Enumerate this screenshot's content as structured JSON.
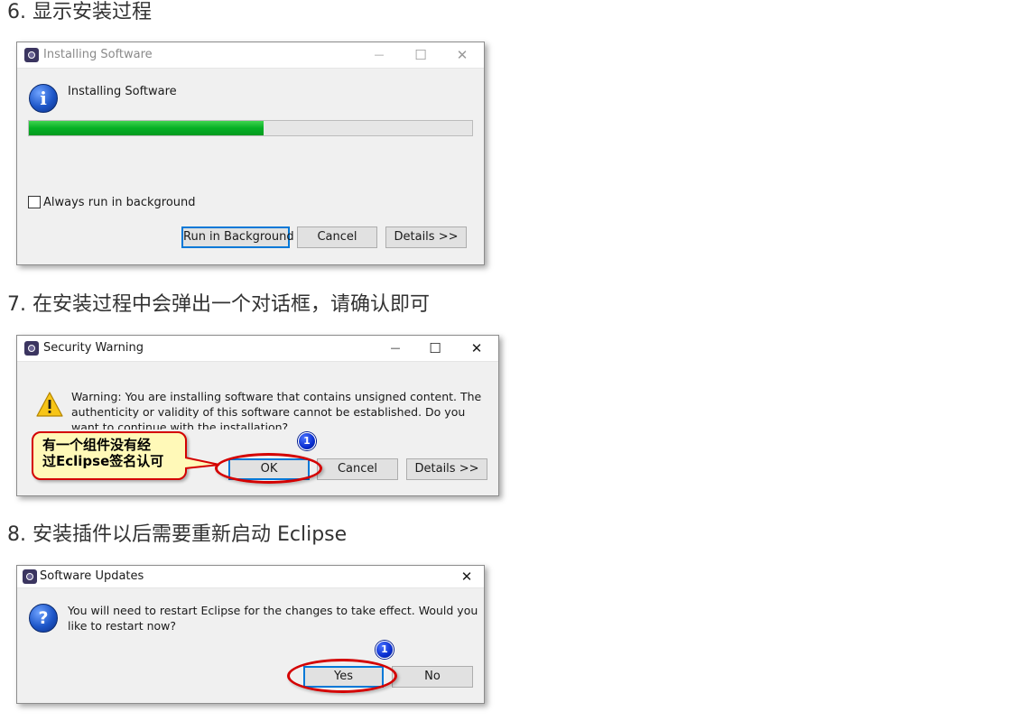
{
  "headings": {
    "step6": "6. 显示安装过程",
    "step7": "7. 在安装过程中会弹出一个对话框，请确认即可",
    "step8": "8. 安装插件以后需要重新启动 Eclipse"
  },
  "installing_dialog": {
    "title": "Installing Software",
    "message": "Installing Software",
    "progress_fraction": 0.53,
    "always_background_label": "Always run in background",
    "always_background_checked": false,
    "buttons": {
      "run_background": "Run in Background",
      "cancel": "Cancel",
      "details": "Details >>"
    }
  },
  "security_dialog": {
    "title": "Security Warning",
    "message": "Warning: You are installing software that contains unsigned content. The authenticity or validity of this software cannot be established. Do you want to continue with the installation?",
    "buttons": {
      "ok": "OK",
      "cancel": "Cancel",
      "details": "Details >>"
    },
    "callout_line1": "有一个组件没有经",
    "callout_line2": "过Eclipse签名认可",
    "badge": "1"
  },
  "updates_dialog": {
    "title": "Software Updates",
    "message": "You will need to restart Eclipse for the changes to take effect. Would you like to restart now?",
    "buttons": {
      "yes": "Yes",
      "no": "No"
    },
    "badge": "1"
  },
  "window_controls": {
    "minimize": "—",
    "maximize": "☐",
    "close": "✕"
  },
  "colors": {
    "progress_green": "#06b025",
    "annotation_red": "#d40000",
    "default_button_border": "#0078d7",
    "callout_fill": "#fff9b8"
  }
}
